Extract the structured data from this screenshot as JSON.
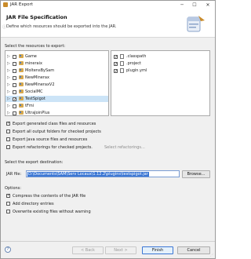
{
  "window": {
    "title": "JAR Export",
    "min": "─",
    "max": "☐",
    "close": "✕"
  },
  "header": {
    "title": "JAR File Specification",
    "description": "Define which resources should be exported into the JAR."
  },
  "resources": {
    "label": "Select the resources to export:",
    "projects": [
      {
        "name": "Game",
        "checked": false
      },
      {
        "name": "mineraix",
        "checked": false
      },
      {
        "name": "MoltensBySam",
        "checked": false
      },
      {
        "name": "NewMinerax",
        "checked": false
      },
      {
        "name": "NewMineraxV2",
        "checked": false
      },
      {
        "name": "SocialMC",
        "checked": false
      },
      {
        "name": "TestSpigot",
        "checked": true,
        "selected": true
      },
      {
        "name": "tFmi",
        "checked": false
      },
      {
        "name": "UltraJoinPlus",
        "checked": false
      }
    ],
    "files": [
      {
        "name": ".classpath",
        "checked": true
      },
      {
        "name": ".project",
        "checked": true
      },
      {
        "name": "plugin.yml",
        "checked": true
      }
    ]
  },
  "options_top": [
    {
      "text": "Export generated class files and resources",
      "checked": true
    },
    {
      "text": "Export all output folders for checked projects",
      "checked": false
    },
    {
      "text": "Export Java source files and resources",
      "checked": false
    },
    {
      "text": "Export refactorings for checked projects.",
      "checked": false,
      "link": "Select refactorings..."
    }
  ],
  "destination": {
    "label": "Select the export destination:",
    "field_label": "JAR file:",
    "path": "D:\\Documents\\SAM\\Serv Locaux\\1.12.2\\plugins\\testspigot.jar",
    "browse": "Browse..."
  },
  "options_label": "Options:",
  "options_bottom": [
    {
      "text": "Compress the contents of the JAR file",
      "checked": true
    },
    {
      "text": "Add directory entries",
      "checked": false
    },
    {
      "text": "Overwrite existing files without warning",
      "checked": false
    }
  ],
  "buttons": {
    "help": "?",
    "back": "< Back",
    "next": "Next >",
    "finish": "Finish",
    "cancel": "Cancel"
  },
  "colors": {
    "selection": "#cce4f7",
    "accent": "#3a76d4",
    "link": "#5a7fb0"
  }
}
